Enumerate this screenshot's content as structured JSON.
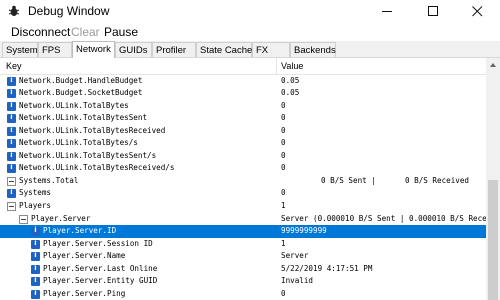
{
  "window": {
    "title": "Debug Window"
  },
  "menu": {
    "disconnect": "Disconnect",
    "clear": "Clear",
    "pause": "Pause"
  },
  "tabs": [
    "System",
    "FPS",
    "Network",
    "GUIDs",
    "Profiler",
    "State Cache",
    "FX",
    "Backends"
  ],
  "active_tab": "Network",
  "columns": {
    "key": "Key",
    "value": "Value"
  },
  "rows": [
    {
      "key": "Network.Budget.HandleBudget",
      "value": "0.05",
      "icon": "info-icon",
      "indent": 0
    },
    {
      "key": "Network.Budget.SocketBudget",
      "value": "0.05",
      "icon": "info-icon",
      "indent": 0
    },
    {
      "key": "Network.ULink.TotalBytes",
      "value": "0",
      "icon": "info-icon",
      "indent": 0
    },
    {
      "key": "Network.ULink.TotalBytesSent",
      "value": "0",
      "icon": "info-icon",
      "indent": 0
    },
    {
      "key": "Network.ULink.TotalBytesReceived",
      "value": "0",
      "icon": "info-icon",
      "indent": 0
    },
    {
      "key": "Network.ULink.TotalBytes/s",
      "value": "0",
      "icon": "info-icon",
      "indent": 0
    },
    {
      "key": "Network.ULink.TotalBytesSent/s",
      "value": "0",
      "icon": "info-icon",
      "indent": 0
    },
    {
      "key": "Network.ULink.TotalBytesReceived/s",
      "value": "0",
      "icon": "info-icon",
      "indent": 0
    },
    {
      "key": "Systems.Total",
      "value": "0 B/S Sent |",
      "value2": "0 B/S Received",
      "icon": "expand-icon",
      "indent": 0,
      "value_offset": 40
    },
    {
      "key": "Systems",
      "value": "0",
      "icon": "info-icon",
      "indent": 0
    },
    {
      "key": "Players",
      "value": "1",
      "icon": "expand-icon",
      "indent": 0
    },
    {
      "key": "Player.Server",
      "value": "Server (0.000010 B/S Sent | 0.000010 B/S Rece",
      "icon": "expand-icon",
      "indent": 1
    },
    {
      "key": "Player.Server.ID",
      "value": "9999999999",
      "icon": "info-icon",
      "indent": 2,
      "selected": true
    },
    {
      "key": "Player.Server.Session ID",
      "value": "1",
      "icon": "info-icon",
      "indent": 2
    },
    {
      "key": "Player.Server.Name",
      "value": "Server",
      "icon": "info-icon",
      "indent": 2
    },
    {
      "key": "Player.Server.Last Online",
      "value": "5/22/2019 4:17:51 PM",
      "icon": "info-icon",
      "indent": 2
    },
    {
      "key": "Player.Server.Entity GUID",
      "value": "Invalid",
      "icon": "info-icon",
      "indent": 2
    },
    {
      "key": "Player.Server.Ping",
      "value": "0",
      "icon": "info-icon",
      "indent": 2
    }
  ],
  "colors": {
    "selection": "#0078d7",
    "info_icon": "#1e63c4"
  }
}
